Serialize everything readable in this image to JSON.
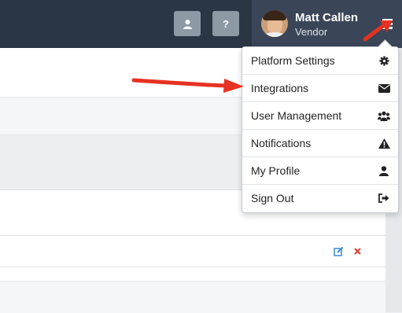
{
  "header": {
    "icon_buttons": [
      {
        "icon": "user-icon"
      },
      {
        "label": "?"
      }
    ],
    "user": {
      "name": "Matt Callen",
      "role": "Vendor",
      "avatar_icon": "avatar-photo"
    },
    "menu_icon": "hamburger-menu-icon"
  },
  "dropdown_menu": {
    "items": [
      {
        "label": "Platform Settings",
        "icon": "gear-icon"
      },
      {
        "label": "Integrations",
        "icon": "envelope-icon"
      },
      {
        "label": "User Management",
        "icon": "users-icon"
      },
      {
        "label": "Notifications",
        "icon": "warning-icon"
      },
      {
        "label": "My Profile",
        "icon": "user-icon"
      },
      {
        "label": "Sign Out",
        "icon": "sign-out-icon"
      }
    ]
  },
  "content": {
    "row_actions": {
      "edit_icon": "edit-icon",
      "delete_icon": "delete-icon"
    }
  },
  "annotations": {
    "arrow_color": "#e63222"
  },
  "colors": {
    "topbar_bg": "#2b3645",
    "user_bg": "#3a4658",
    "edit_blue": "#3a8ad8",
    "delete_red": "#d9423a"
  }
}
